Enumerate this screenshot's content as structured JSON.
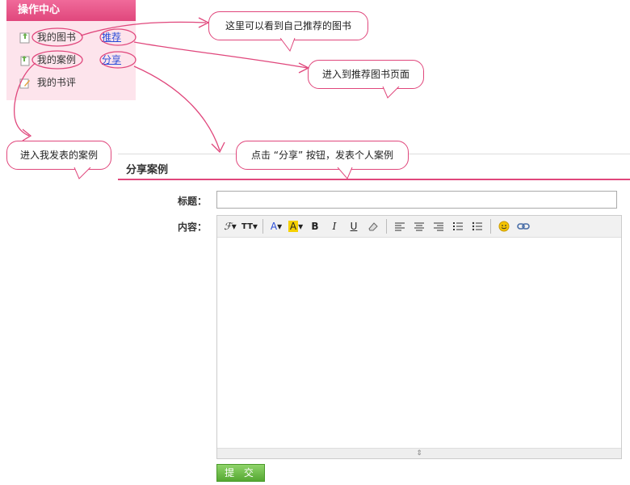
{
  "sidebar": {
    "title": "操作中心",
    "items": [
      {
        "label": "我的图书",
        "link": "推荐"
      },
      {
        "label": "我的案例",
        "link": "分享"
      },
      {
        "label": "我的书评"
      }
    ]
  },
  "callouts": {
    "recommend_view": "这里可以看到自己推荐的图书",
    "recommend_page": "进入到推荐图书页面",
    "my_cases": "进入我发表的案例",
    "share_hint": "点击 “分享” 按钮，发表个人案例"
  },
  "section": {
    "title": "分享案例"
  },
  "form": {
    "title_label": "标题：",
    "content_label": "内容：",
    "title_value": "",
    "submit_label": "提 交"
  },
  "toolbar_icons": [
    "font-family-icon",
    "font-size-icon",
    "font-color-icon",
    "highlight-icon",
    "bold-icon",
    "italic-icon",
    "underline-icon",
    "eraser-icon",
    "align-left-icon",
    "align-center-icon",
    "align-right-icon",
    "ordered-list-icon",
    "unordered-list-icon",
    "emoticon-icon",
    "link-icon"
  ],
  "colors": {
    "accent": "#e0477c",
    "sidebar_bg": "#fde4ec",
    "link": "#2a4dd8",
    "submit": "#55a832"
  }
}
